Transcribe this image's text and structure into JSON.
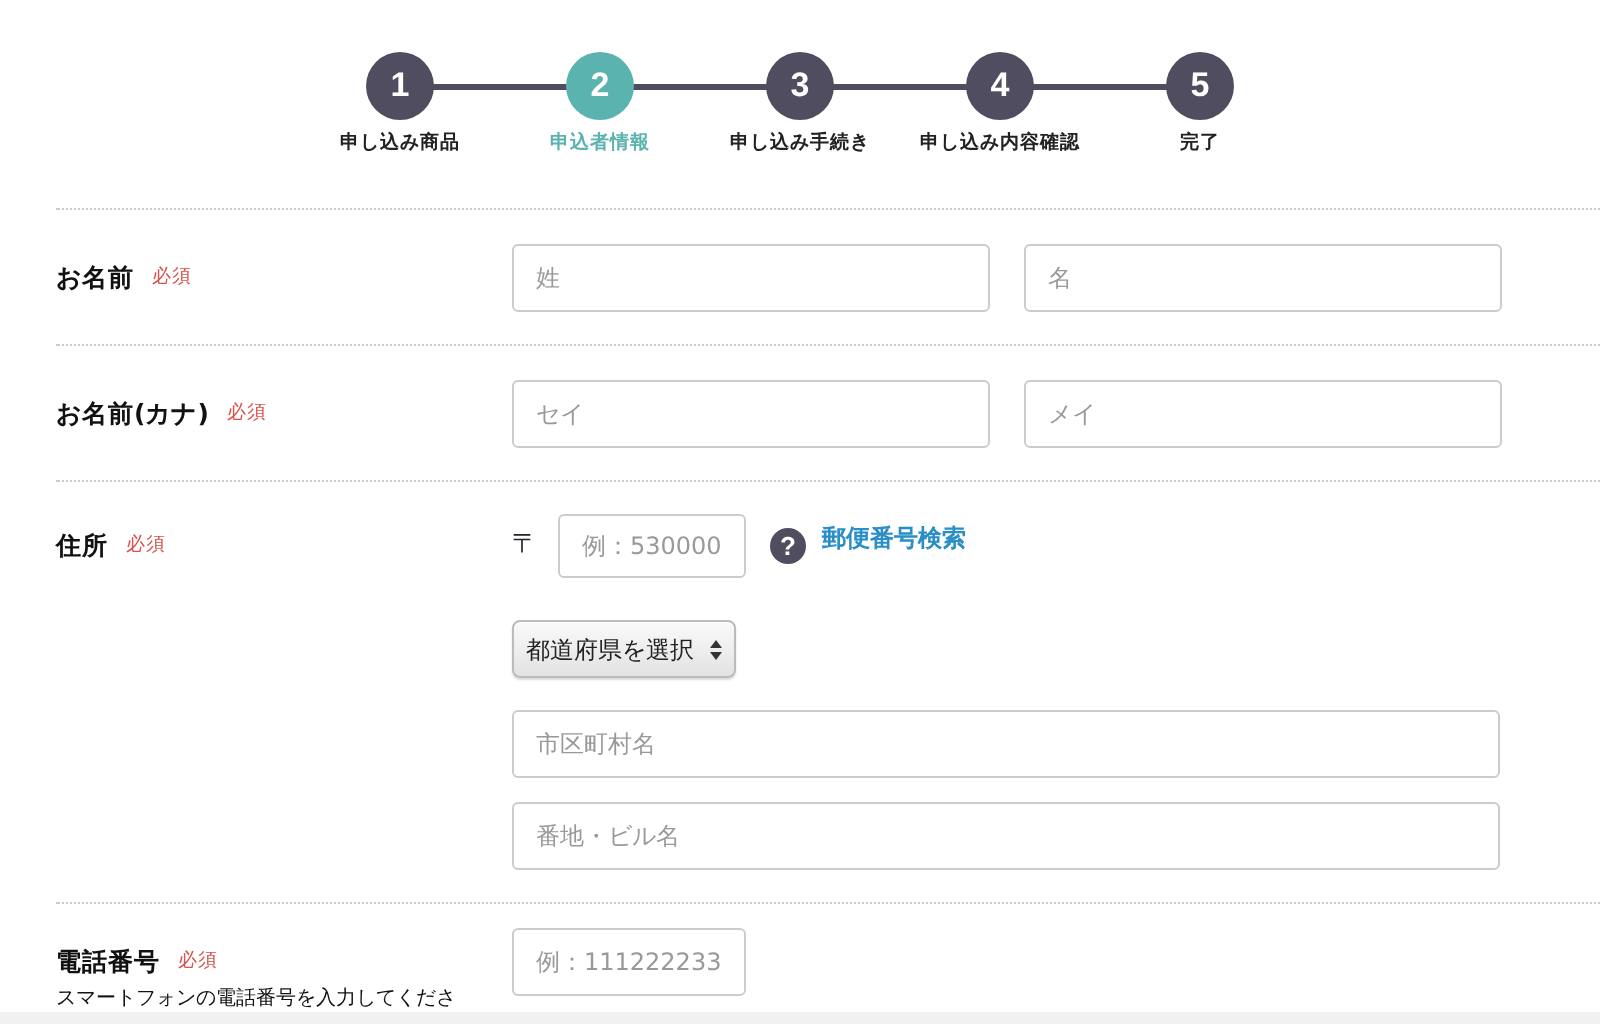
{
  "steps": [
    {
      "number": "1",
      "label": "申し込み商品",
      "selected": false
    },
    {
      "number": "2",
      "label": "申込者情報",
      "selected": true
    },
    {
      "number": "3",
      "label": "申し込み手続き",
      "selected": false
    },
    {
      "number": "4",
      "label": "申し込み内容確認",
      "selected": false
    },
    {
      "number": "5",
      "label": "完了",
      "selected": false
    }
  ],
  "form": [
    {
      "kind": "pair",
      "label": "お名前",
      "required": "必須",
      "placeholders": [
        "姓",
        "名"
      ]
    },
    {
      "kind": "pair",
      "label": "お名前(カナ)",
      "required": "必須",
      "placeholders": [
        "セイ",
        "メイ"
      ]
    },
    {
      "kind": "address",
      "label": "住所",
      "required": "必須",
      "postal_mark": "〒",
      "postal_placeholder": "例：530000",
      "help_icon": "?",
      "postal_link": "郵便番号検索",
      "prefecture_select": "都道府県を選択",
      "placeholders": [
        "市区町村名",
        "番地・ビル名"
      ]
    },
    {
      "kind": "phone",
      "label": "電話番号",
      "required": "必須",
      "hint": "スマートフォンの電話番号を入力してくださ",
      "placeholder": "例：111222233"
    }
  ]
}
